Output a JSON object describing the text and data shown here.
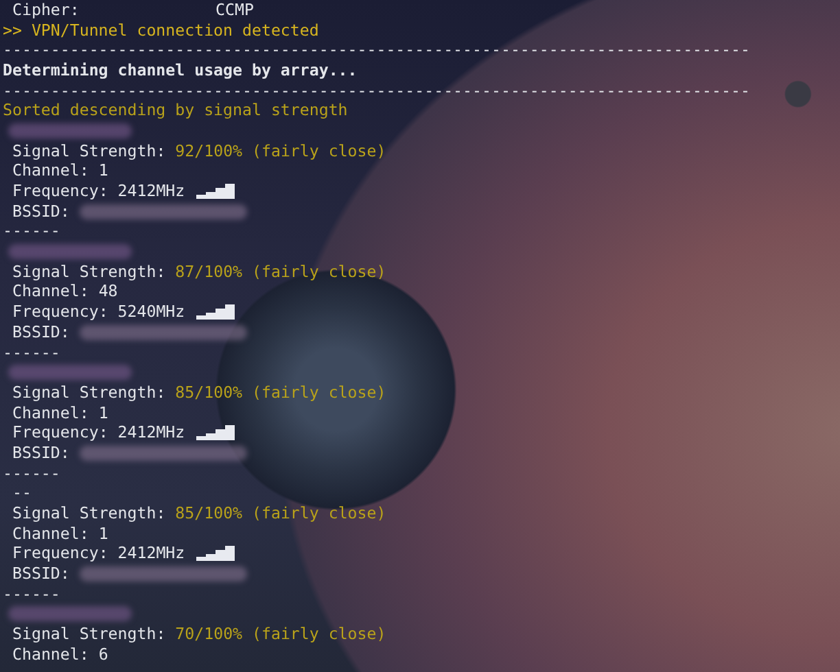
{
  "cipher": {
    "label": "Cipher:",
    "value": "CCMP"
  },
  "notice": ">> VPN/Tunnel connection detected",
  "separator_1": "------------------------------------------------------------------------------",
  "heading": "Determining channel usage by array...",
  "separator_2": "------------------------------------------------------------------------------",
  "sort_note": "Sorted descending by signal strength",
  "networks": [
    {
      "ssid_redacted": true,
      "signal_label": "Signal Strength:",
      "signal": "92/100% (fairly close)",
      "channel": "Channel: 1",
      "frequency": "Frequency: 2412MHz",
      "bssid_label": "BSSID:",
      "bssid_redacted": true,
      "end": "------"
    },
    {
      "ssid_redacted": true,
      "signal_label": "Signal Strength:",
      "signal": "87/100% (fairly close)",
      "channel": "Channel: 48",
      "frequency": "Frequency: 5240MHz",
      "bssid_label": "BSSID:",
      "bssid_redacted": true,
      "end": "------"
    },
    {
      "ssid_redacted": true,
      "signal_label": "Signal Strength:",
      "signal": "85/100% (fairly close)",
      "channel": "Channel: 1",
      "frequency": "Frequency: 2412MHz",
      "bssid_label": "BSSID:",
      "bssid_redacted": true,
      "end": "------"
    },
    {
      "ssid": "--",
      "signal_label": "Signal Strength:",
      "signal": "85/100% (fairly close)",
      "channel": "Channel: 1",
      "frequency": "Frequency: 2412MHz",
      "bssid_label": "BSSID:",
      "bssid_redacted": true,
      "end": "------"
    },
    {
      "ssid_redacted": true,
      "signal_label": "Signal Strength:",
      "signal": "70/100% (fairly close)",
      "channel": "Channel: 6"
    }
  ]
}
